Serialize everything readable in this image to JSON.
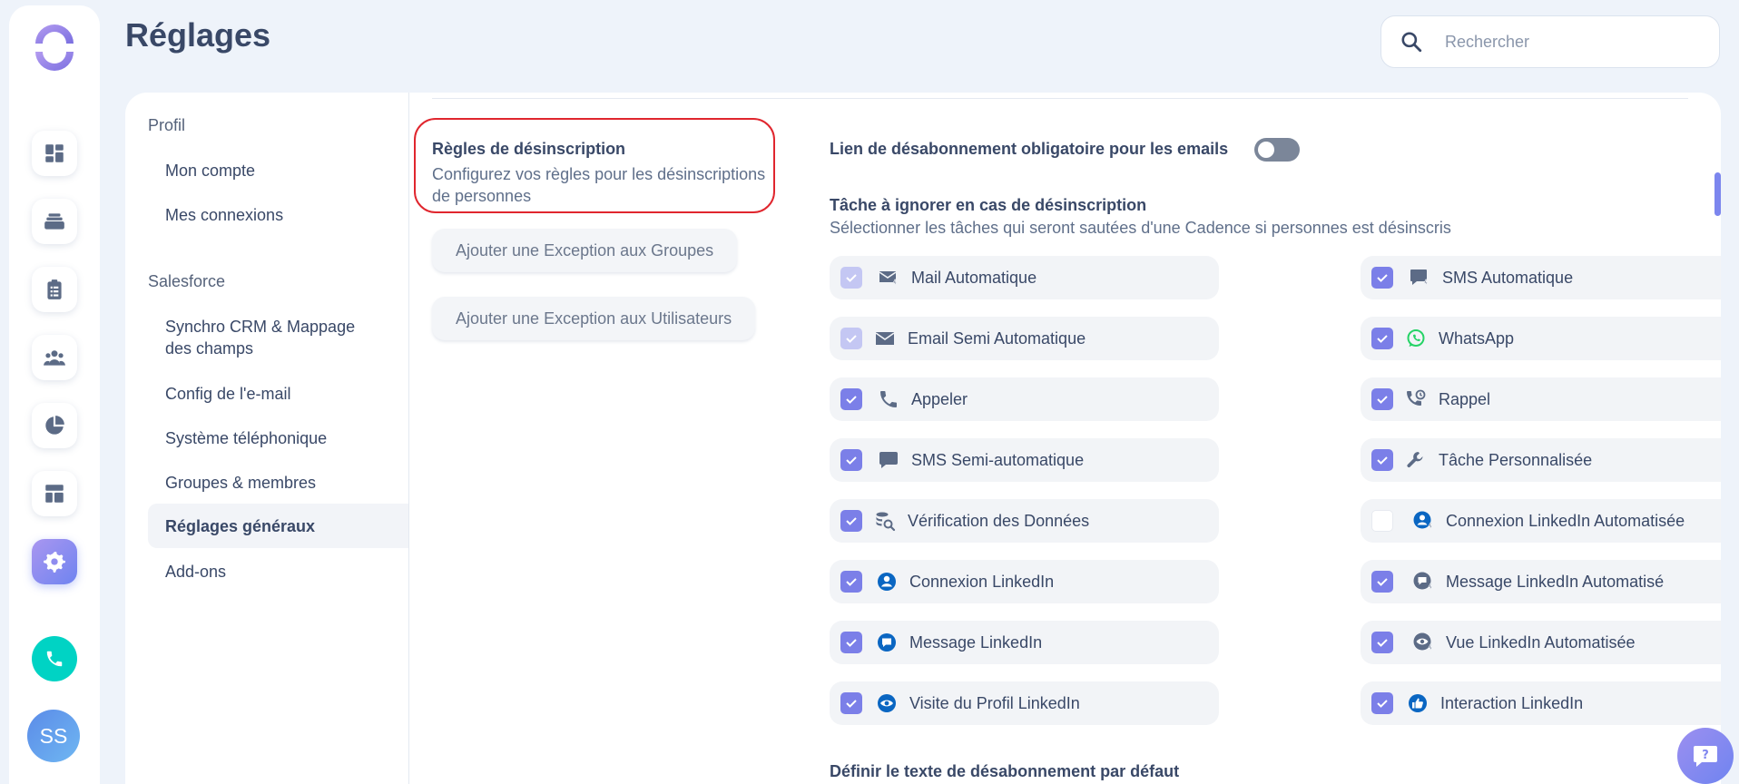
{
  "header": {
    "title": "Réglages",
    "search_placeholder": "Rechercher"
  },
  "rail": {
    "items": [
      "dashboard-icon",
      "tasks-stack-icon",
      "clipboard-icon",
      "people-icon",
      "pie-chart-icon",
      "template-icon",
      "gear-icon"
    ],
    "active": "gear-icon",
    "avatar_initials": "SS"
  },
  "settings_nav": {
    "sections": [
      {
        "title": "Profil",
        "items": [
          "Mon compte",
          "Mes connexions"
        ]
      },
      {
        "title": "Salesforce",
        "items": [
          "Synchro CRM & Mappage des champs",
          "Config de l'e-mail",
          "Système téléphonique",
          "Groupes & membres",
          "Réglages généraux",
          "Add-ons"
        ]
      }
    ],
    "active_item": "Réglages généraux"
  },
  "unsubscribe": {
    "title": "Règles de désinscription",
    "description": "Configurez vos règles pour les désinscriptions de personnes",
    "group_exception_label": "Ajouter une Exception aux Groupes",
    "user_exception_label": "Ajouter une Exception aux Utilisateurs",
    "mandatory_link_label": "Lien de désabonnement obligatoire pour les emails",
    "mandatory_link_enabled": false,
    "skip_tasks_title": "Tâche à ignorer en cas de désinscription",
    "skip_tasks_subtitle": "Sélectionner les tâches qui seront sautées d'une Cadence si personnes est désinscris",
    "tasks": [
      {
        "label": "Mail Automatique",
        "state": "checked-disabled",
        "icon": "mail-auto-icon"
      },
      {
        "label": "SMS Automatique",
        "state": "checked",
        "icon": "sms-auto-icon"
      },
      {
        "label": "Email Semi Automatique",
        "state": "checked-disabled",
        "icon": "mail-icon"
      },
      {
        "label": "WhatsApp",
        "state": "checked",
        "icon": "whatsapp-icon"
      },
      {
        "label": "Appeler",
        "state": "checked",
        "icon": "phone-icon"
      },
      {
        "label": "Rappel",
        "state": "checked",
        "icon": "callback-icon"
      },
      {
        "label": "SMS Semi-automatique",
        "state": "checked",
        "icon": "chat-bubble-icon"
      },
      {
        "label": "Tâche Personnalisée",
        "state": "checked",
        "icon": "wrench-icon"
      },
      {
        "label": "Vérification des Données",
        "state": "checked",
        "icon": "data-check-icon"
      },
      {
        "label": "Connexion LinkedIn Automatisée",
        "state": "unchecked",
        "icon": "linkedin-auto-connect-icon"
      },
      {
        "label": "Connexion LinkedIn",
        "state": "checked",
        "icon": "linkedin-connect-icon"
      },
      {
        "label": "Message LinkedIn Automatisé",
        "state": "checked",
        "icon": "linkedin-auto-message-icon"
      },
      {
        "label": "Message LinkedIn",
        "state": "checked",
        "icon": "linkedin-message-icon"
      },
      {
        "label": "Vue LinkedIn Automatisée",
        "state": "checked",
        "icon": "linkedin-auto-view-icon"
      },
      {
        "label": "Visite du Profil LinkedIn",
        "state": "checked",
        "icon": "eye-icon"
      },
      {
        "label": "Interaction LinkedIn",
        "state": "checked",
        "icon": "thumbs-up-icon"
      }
    ],
    "default_text_title": "Définir le texte de désabonnement par défaut"
  },
  "colors": {
    "accent": "#7b7fe8",
    "linkedin": "#0a66c2",
    "whatsapp": "#25d366",
    "highlight": "#e0262e",
    "teal": "#00d3c4"
  }
}
